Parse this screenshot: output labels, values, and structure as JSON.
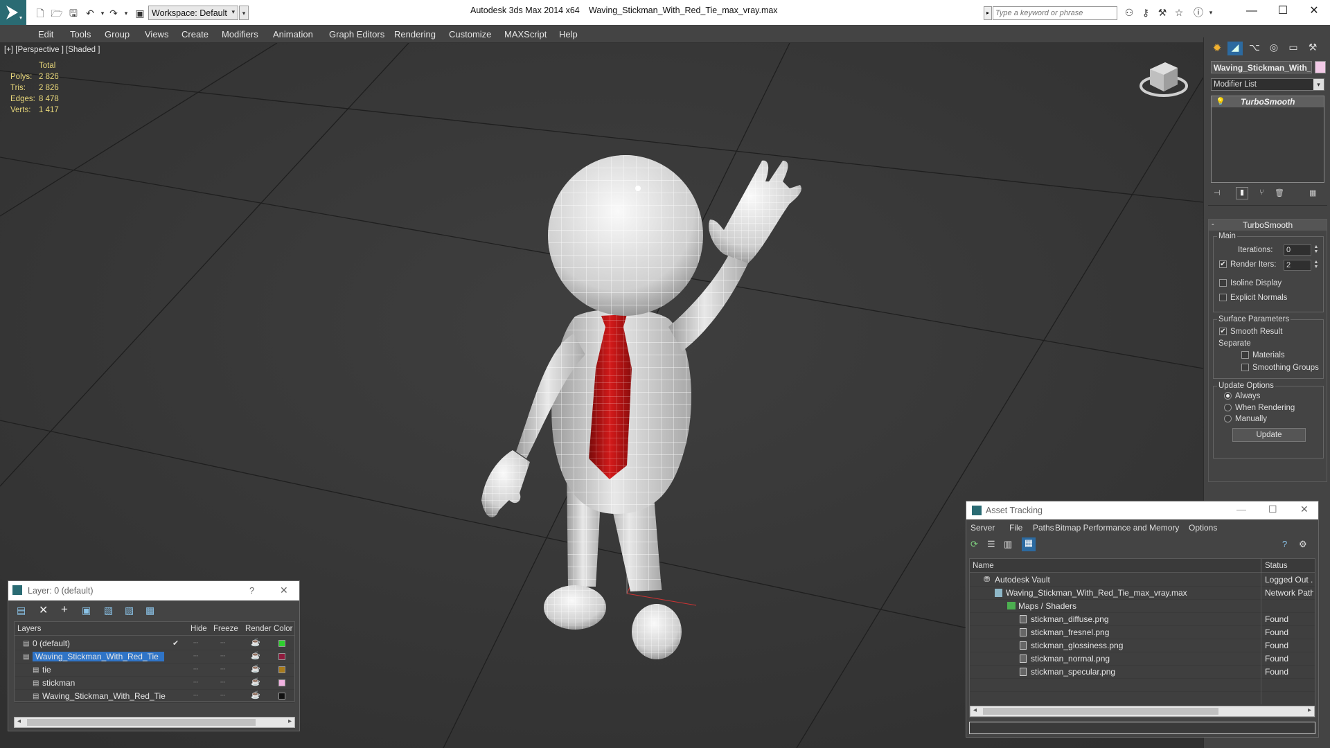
{
  "titlebar": {
    "app_title": "Autodesk 3ds Max  2014 x64",
    "file_title": "Waving_Stickman_With_Red_Tie_max_vray.max",
    "workspace_label": "Workspace: Default",
    "search_placeholder": "Type a keyword or phrase"
  },
  "menu": [
    "Edit",
    "Tools",
    "Group",
    "Views",
    "Create",
    "Modifiers",
    "Animation",
    "Graph Editors",
    "Rendering",
    "Customize",
    "MAXScript",
    "Help"
  ],
  "viewport": {
    "label": "[+] [Perspective ] [Shaded ]",
    "stats": {
      "header": "Total",
      "rows": [
        {
          "label": "Polys:",
          "value": "2 826"
        },
        {
          "label": "Tris:",
          "value": "2 826"
        },
        {
          "label": "Edges:",
          "value": "8 478"
        },
        {
          "label": "Verts:",
          "value": "1 417"
        }
      ]
    }
  },
  "command_panel": {
    "object_name": "Waving_Stickman_With_",
    "modifier_list_label": "Modifier List",
    "stack_item": "TurboSmooth",
    "rollout_title": "TurboSmooth",
    "main_label": "Main",
    "iterations_label": "Iterations:",
    "iterations_value": "0",
    "render_iters_label": "Render Iters:",
    "render_iters_value": "2",
    "isoline_label": "Isoline Display",
    "explicit_normals_label": "Explicit Normals",
    "surface_params_label": "Surface Parameters",
    "smooth_result_label": "Smooth Result",
    "separate_label": "Separate",
    "materials_label": "Materials",
    "smoothing_groups_label": "Smoothing Groups",
    "update_options_label": "Update Options",
    "always_label": "Always",
    "when_rendering_label": "When Rendering",
    "manually_label": "Manually",
    "update_button": "Update",
    "colors": {
      "object_swatch": "#f2c9e6"
    }
  },
  "layer_window": {
    "title": "Layer: 0 (default)",
    "columns": [
      "Layers",
      "Hide",
      "Freeze",
      "Render",
      "Color"
    ],
    "rows": [
      {
        "name": "0 (default)",
        "color": "#2ed12e",
        "indent": 1,
        "selected": false,
        "check": "✔"
      },
      {
        "name": "Waving_Stickman_With_Red_Tie",
        "color": "#8f1b3d",
        "indent": 1,
        "selected": true,
        "check": ""
      },
      {
        "name": "tie",
        "color": "#a77a1c",
        "indent": 2,
        "selected": false,
        "check": ""
      },
      {
        "name": "stickman",
        "color": "#f0b1e0",
        "indent": 2,
        "selected": false,
        "check": ""
      },
      {
        "name": "Waving_Stickman_With_Red_Tie",
        "color": "#111111",
        "indent": 2,
        "selected": false,
        "check": ""
      }
    ]
  },
  "asset_window": {
    "title": "Asset Tracking",
    "menu": [
      "Server",
      "File",
      "Paths",
      "Bitmap Performance and Memory",
      "Options"
    ],
    "columns": [
      "Name",
      "Status"
    ],
    "rows": [
      {
        "name": "Autodesk Vault",
        "status": "Logged Out ...",
        "indent": 1
      },
      {
        "name": "Waving_Stickman_With_Red_Tie_max_vray.max",
        "status": "Network Path",
        "indent": 2
      },
      {
        "name": "Maps / Shaders",
        "status": "",
        "indent": 3
      },
      {
        "name": "stickman_diffuse.png",
        "status": "Found",
        "indent": 4
      },
      {
        "name": "stickman_fresnel.png",
        "status": "Found",
        "indent": 4
      },
      {
        "name": "stickman_glossiness.png",
        "status": "Found",
        "indent": 4
      },
      {
        "name": "stickman_normal.png",
        "status": "Found",
        "indent": 4
      },
      {
        "name": "stickman_specular.png",
        "status": "Found",
        "indent": 4
      }
    ]
  }
}
